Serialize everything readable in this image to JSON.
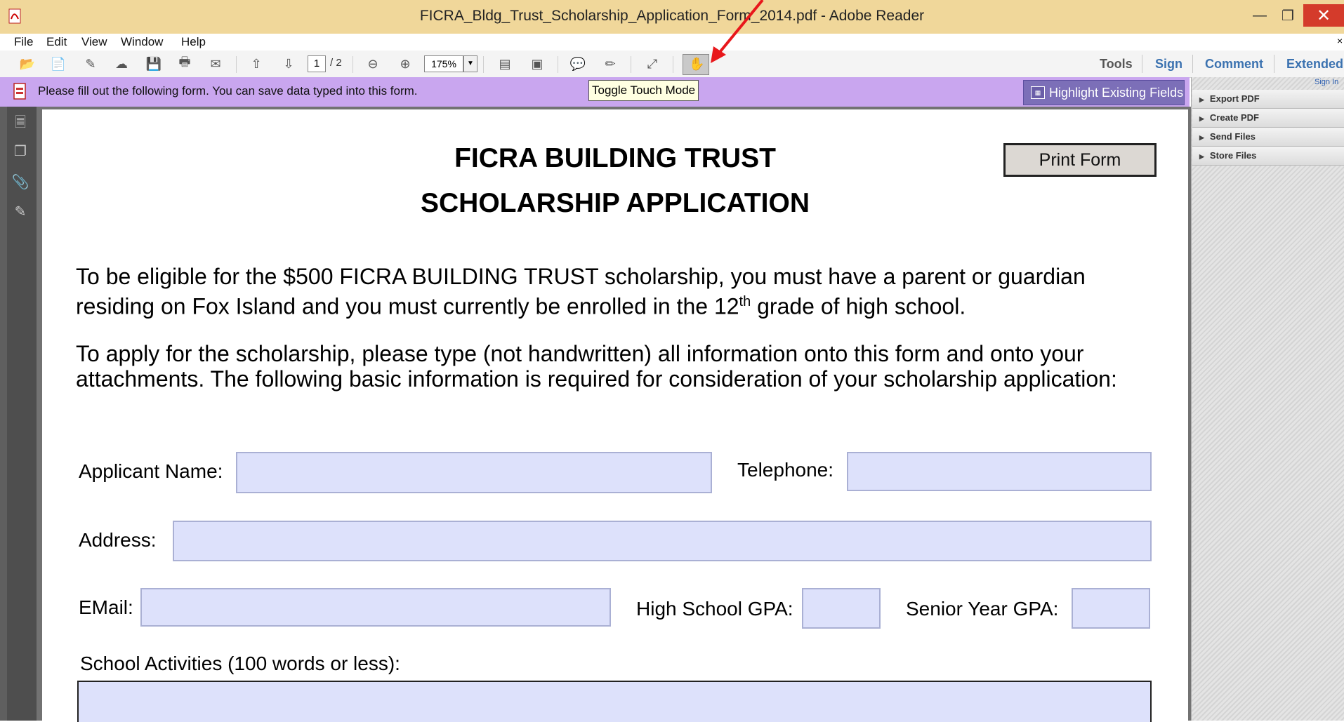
{
  "window": {
    "title": "FICRA_Bldg_Trust_Scholarship_Application_Form_2014.pdf - Adobe Reader"
  },
  "menu": [
    "File",
    "Edit",
    "View",
    "Window",
    "Help"
  ],
  "toolbar": {
    "page_current": "1",
    "page_total": "/ 2",
    "zoom": "175%",
    "tabs": [
      "Tools",
      "Sign",
      "Comment",
      "Extended"
    ]
  },
  "tooltip": "Toggle Touch Mode",
  "notice": {
    "text": "Please fill out the following form. You can save data typed into this form.",
    "highlight_button": "Highlight Existing Fields"
  },
  "right_pane": {
    "sign_in": "Sign In",
    "items": [
      "Export PDF",
      "Create PDF",
      "Send Files",
      "Store Files"
    ]
  },
  "document": {
    "print_button": "Print Form",
    "title_line1": "FICRA BUILDING TRUST",
    "title_line2": "SCHOLARSHIP APPLICATION",
    "para1_a": "To be eligible for the $500 FICRA BUILDING TRUST scholarship, you must have a parent or guardian residing on Fox Island and you must currently be enrolled in the 12",
    "para1_sup": "th",
    "para1_b": " grade of high school.",
    "para2": "To apply for the scholarship, please type (not handwritten) all information onto this form and onto your attachments.  The following basic information is required for consideration of your scholarship application:",
    "fields": {
      "applicant_name_label": "Applicant Name:",
      "telephone_label": "Telephone:",
      "address_label": "Address:",
      "email_label": "EMail:",
      "hs_gpa_label": "High School GPA:",
      "senior_gpa_label": "Senior Year GPA:",
      "activities_label": "School Activities (100 words or less):"
    }
  }
}
